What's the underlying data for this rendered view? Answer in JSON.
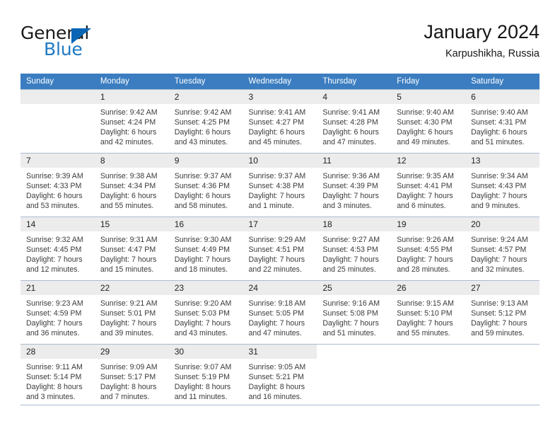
{
  "brand": {
    "name_part1": "General",
    "name_part2": "Blue",
    "logo_icon": "blue-triangle-icon"
  },
  "header": {
    "title": "January 2024",
    "subtitle": "Karpushikha, Russia"
  },
  "colors": {
    "header_blue": "#3b7dc0",
    "brand_blue": "#1f7ac4",
    "logo_triangle": "#0a66b5",
    "daynum_bg": "#ececec",
    "grid_line": "#a9bcd0"
  },
  "weekdays": [
    "Sunday",
    "Monday",
    "Tuesday",
    "Wednesday",
    "Thursday",
    "Friday",
    "Saturday"
  ],
  "labels": {
    "sunrise": "Sunrise:",
    "sunset": "Sunset:",
    "daylight": "Daylight:"
  },
  "weeks": [
    [
      {
        "day": "",
        "empty": true,
        "sunrise": "",
        "sunset": "",
        "daylight1": "",
        "daylight2": ""
      },
      {
        "day": "1",
        "sunrise": "Sunrise: 9:42 AM",
        "sunset": "Sunset: 4:24 PM",
        "daylight1": "Daylight: 6 hours",
        "daylight2": "and 42 minutes."
      },
      {
        "day": "2",
        "sunrise": "Sunrise: 9:42 AM",
        "sunset": "Sunset: 4:25 PM",
        "daylight1": "Daylight: 6 hours",
        "daylight2": "and 43 minutes."
      },
      {
        "day": "3",
        "sunrise": "Sunrise: 9:41 AM",
        "sunset": "Sunset: 4:27 PM",
        "daylight1": "Daylight: 6 hours",
        "daylight2": "and 45 minutes."
      },
      {
        "day": "4",
        "sunrise": "Sunrise: 9:41 AM",
        "sunset": "Sunset: 4:28 PM",
        "daylight1": "Daylight: 6 hours",
        "daylight2": "and 47 minutes."
      },
      {
        "day": "5",
        "sunrise": "Sunrise: 9:40 AM",
        "sunset": "Sunset: 4:30 PM",
        "daylight1": "Daylight: 6 hours",
        "daylight2": "and 49 minutes."
      },
      {
        "day": "6",
        "sunrise": "Sunrise: 9:40 AM",
        "sunset": "Sunset: 4:31 PM",
        "daylight1": "Daylight: 6 hours",
        "daylight2": "and 51 minutes."
      }
    ],
    [
      {
        "day": "7",
        "sunrise": "Sunrise: 9:39 AM",
        "sunset": "Sunset: 4:33 PM",
        "daylight1": "Daylight: 6 hours",
        "daylight2": "and 53 minutes."
      },
      {
        "day": "8",
        "sunrise": "Sunrise: 9:38 AM",
        "sunset": "Sunset: 4:34 PM",
        "daylight1": "Daylight: 6 hours",
        "daylight2": "and 55 minutes."
      },
      {
        "day": "9",
        "sunrise": "Sunrise: 9:37 AM",
        "sunset": "Sunset: 4:36 PM",
        "daylight1": "Daylight: 6 hours",
        "daylight2": "and 58 minutes."
      },
      {
        "day": "10",
        "sunrise": "Sunrise: 9:37 AM",
        "sunset": "Sunset: 4:38 PM",
        "daylight1": "Daylight: 7 hours",
        "daylight2": "and 1 minute."
      },
      {
        "day": "11",
        "sunrise": "Sunrise: 9:36 AM",
        "sunset": "Sunset: 4:39 PM",
        "daylight1": "Daylight: 7 hours",
        "daylight2": "and 3 minutes."
      },
      {
        "day": "12",
        "sunrise": "Sunrise: 9:35 AM",
        "sunset": "Sunset: 4:41 PM",
        "daylight1": "Daylight: 7 hours",
        "daylight2": "and 6 minutes."
      },
      {
        "day": "13",
        "sunrise": "Sunrise: 9:34 AM",
        "sunset": "Sunset: 4:43 PM",
        "daylight1": "Daylight: 7 hours",
        "daylight2": "and 9 minutes."
      }
    ],
    [
      {
        "day": "14",
        "sunrise": "Sunrise: 9:32 AM",
        "sunset": "Sunset: 4:45 PM",
        "daylight1": "Daylight: 7 hours",
        "daylight2": "and 12 minutes."
      },
      {
        "day": "15",
        "sunrise": "Sunrise: 9:31 AM",
        "sunset": "Sunset: 4:47 PM",
        "daylight1": "Daylight: 7 hours",
        "daylight2": "and 15 minutes."
      },
      {
        "day": "16",
        "sunrise": "Sunrise: 9:30 AM",
        "sunset": "Sunset: 4:49 PM",
        "daylight1": "Daylight: 7 hours",
        "daylight2": "and 18 minutes."
      },
      {
        "day": "17",
        "sunrise": "Sunrise: 9:29 AM",
        "sunset": "Sunset: 4:51 PM",
        "daylight1": "Daylight: 7 hours",
        "daylight2": "and 22 minutes."
      },
      {
        "day": "18",
        "sunrise": "Sunrise: 9:27 AM",
        "sunset": "Sunset: 4:53 PM",
        "daylight1": "Daylight: 7 hours",
        "daylight2": "and 25 minutes."
      },
      {
        "day": "19",
        "sunrise": "Sunrise: 9:26 AM",
        "sunset": "Sunset: 4:55 PM",
        "daylight1": "Daylight: 7 hours",
        "daylight2": "and 28 minutes."
      },
      {
        "day": "20",
        "sunrise": "Sunrise: 9:24 AM",
        "sunset": "Sunset: 4:57 PM",
        "daylight1": "Daylight: 7 hours",
        "daylight2": "and 32 minutes."
      }
    ],
    [
      {
        "day": "21",
        "sunrise": "Sunrise: 9:23 AM",
        "sunset": "Sunset: 4:59 PM",
        "daylight1": "Daylight: 7 hours",
        "daylight2": "and 36 minutes."
      },
      {
        "day": "22",
        "sunrise": "Sunrise: 9:21 AM",
        "sunset": "Sunset: 5:01 PM",
        "daylight1": "Daylight: 7 hours",
        "daylight2": "and 39 minutes."
      },
      {
        "day": "23",
        "sunrise": "Sunrise: 9:20 AM",
        "sunset": "Sunset: 5:03 PM",
        "daylight1": "Daylight: 7 hours",
        "daylight2": "and 43 minutes."
      },
      {
        "day": "24",
        "sunrise": "Sunrise: 9:18 AM",
        "sunset": "Sunset: 5:05 PM",
        "daylight1": "Daylight: 7 hours",
        "daylight2": "and 47 minutes."
      },
      {
        "day": "25",
        "sunrise": "Sunrise: 9:16 AM",
        "sunset": "Sunset: 5:08 PM",
        "daylight1": "Daylight: 7 hours",
        "daylight2": "and 51 minutes."
      },
      {
        "day": "26",
        "sunrise": "Sunrise: 9:15 AM",
        "sunset": "Sunset: 5:10 PM",
        "daylight1": "Daylight: 7 hours",
        "daylight2": "and 55 minutes."
      },
      {
        "day": "27",
        "sunrise": "Sunrise: 9:13 AM",
        "sunset": "Sunset: 5:12 PM",
        "daylight1": "Daylight: 7 hours",
        "daylight2": "and 59 minutes."
      }
    ],
    [
      {
        "day": "28",
        "sunrise": "Sunrise: 9:11 AM",
        "sunset": "Sunset: 5:14 PM",
        "daylight1": "Daylight: 8 hours",
        "daylight2": "and 3 minutes."
      },
      {
        "day": "29",
        "sunrise": "Sunrise: 9:09 AM",
        "sunset": "Sunset: 5:17 PM",
        "daylight1": "Daylight: 8 hours",
        "daylight2": "and 7 minutes."
      },
      {
        "day": "30",
        "sunrise": "Sunrise: 9:07 AM",
        "sunset": "Sunset: 5:19 PM",
        "daylight1": "Daylight: 8 hours",
        "daylight2": "and 11 minutes."
      },
      {
        "day": "31",
        "sunrise": "Sunrise: 9:05 AM",
        "sunset": "Sunset: 5:21 PM",
        "daylight1": "Daylight: 8 hours",
        "daylight2": "and 16 minutes."
      },
      {
        "day": "",
        "blank": true,
        "sunrise": "",
        "sunset": "",
        "daylight1": "",
        "daylight2": ""
      },
      {
        "day": "",
        "blank": true,
        "sunrise": "",
        "sunset": "",
        "daylight1": "",
        "daylight2": ""
      },
      {
        "day": "",
        "blank": true,
        "sunrise": "",
        "sunset": "",
        "daylight1": "",
        "daylight2": ""
      }
    ]
  ]
}
